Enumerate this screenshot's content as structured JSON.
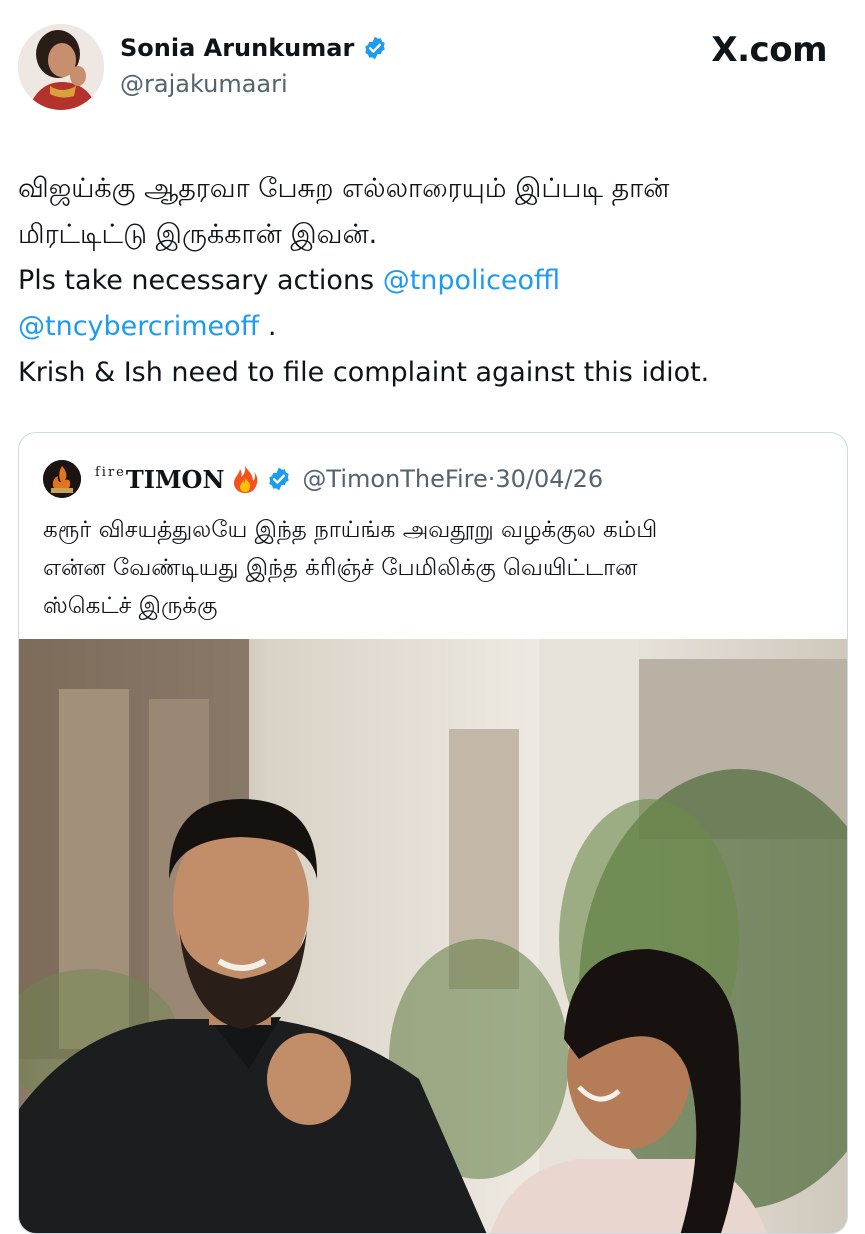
{
  "author": {
    "name": "Sonia Arunkumar",
    "handle": "@rajakumaari"
  },
  "site": {
    "logo_text": "X.com"
  },
  "tweet": {
    "line1": "விஜய்க்கு ஆதரவா பேசுற எல்லாரையும் இப்படி தான்",
    "line2": "மிரட்டிட்டு இருக்கான் இவன்.",
    "line3_prefix": "Pls take necessary actions ",
    "mention1": "@tnpoliceoffl",
    "mention2": "@tncybercrimeoff",
    "line4_suffix": " .",
    "line5": "Krish & Ish need to file complaint against this idiot."
  },
  "quote": {
    "name_sup": "fire",
    "name_main": "TIMON",
    "handle": "@TimonTheFire",
    "separator": "·",
    "date": "30/04/26",
    "line1": "கரூர் விசயத்துலயே இந்த நாய்ங்க அவதூறு வழக்குல கம்பி",
    "line2": "என்ன வேண்டியது இந்த க்ரிஞ்ச் பேமிலிக்கு வெயிட்டான",
    "line3": "ஸ்கெட்ச் இருக்கு"
  },
  "icons": {
    "verified": "verified-badge-icon",
    "fire": "fire-emoji-icon"
  },
  "colors": {
    "link": "#1d9bf0",
    "muted": "#536471",
    "text": "#0f1419",
    "border": "#cfd9de"
  }
}
